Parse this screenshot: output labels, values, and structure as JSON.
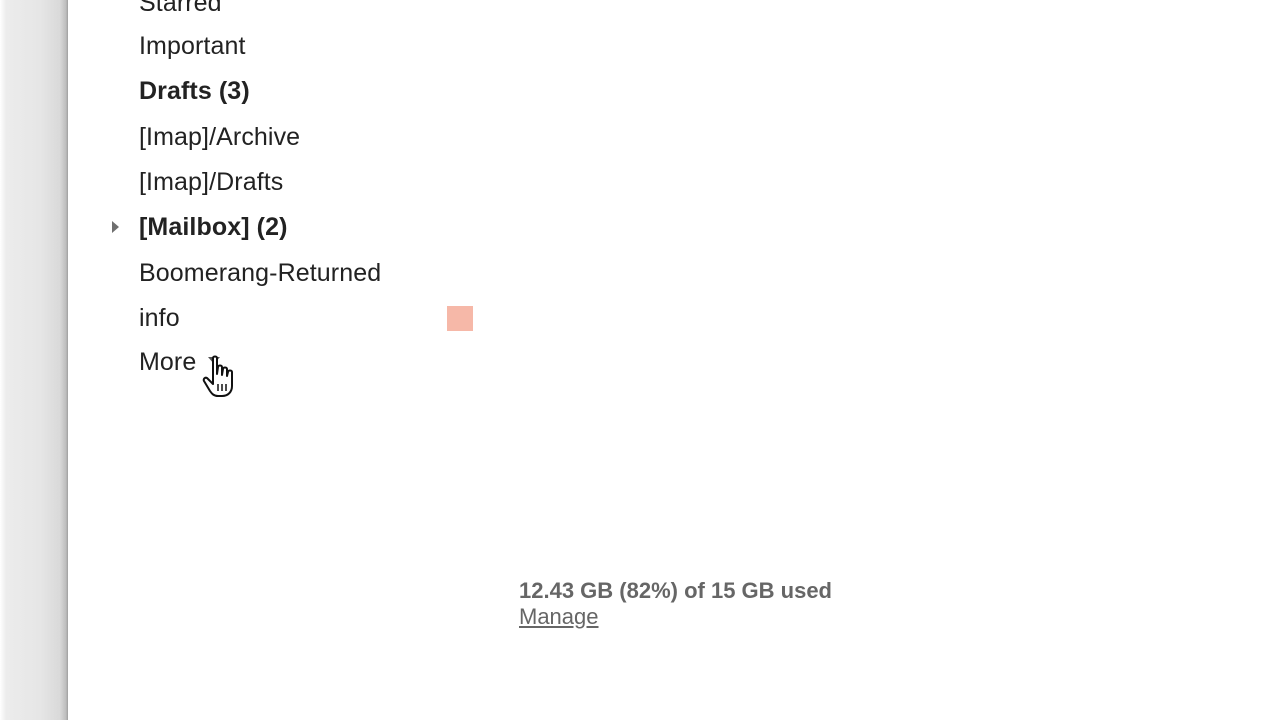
{
  "sidebar": {
    "items": [
      {
        "label": "Starred",
        "bold": false
      },
      {
        "label": "Important",
        "bold": false
      },
      {
        "label": "Drafts (3)",
        "bold": true
      },
      {
        "label": "[Imap]/Archive",
        "bold": false
      },
      {
        "label": "[Imap]/Drafts",
        "bold": false
      },
      {
        "label": "[Mailbox] (2)",
        "bold": true,
        "expandable": true
      },
      {
        "label": "Boomerang-Returned",
        "bold": false
      },
      {
        "label": "info",
        "bold": false,
        "label_color": "#f6b8a8"
      },
      {
        "label": "More",
        "bold": false,
        "has_dropdown": true
      }
    ]
  },
  "storage": {
    "usage_text": "12.43 GB (82%) of 15 GB used",
    "used_gb": 12.43,
    "total_gb": 15,
    "percent_used": 82,
    "manage_label": "Manage"
  },
  "icons": {
    "expand_arrow": "triangle-right-icon",
    "more_dropdown": "caret-down-icon",
    "cursor": "hand-pointer-cursor"
  }
}
